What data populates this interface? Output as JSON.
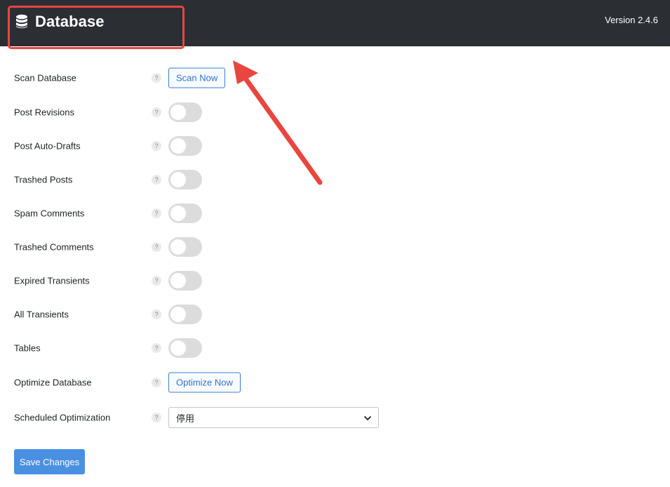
{
  "header": {
    "title": "Database",
    "version": "Version 2.4.6",
    "icon": "database-icon"
  },
  "settings": [
    {
      "label": "Scan Database",
      "help": "?",
      "control": "button",
      "button_label": "Scan Now"
    },
    {
      "label": "Post Revisions",
      "help": "?",
      "control": "toggle",
      "enabled": false
    },
    {
      "label": "Post Auto-Drafts",
      "help": "?",
      "control": "toggle",
      "enabled": false
    },
    {
      "label": "Trashed Posts",
      "help": "?",
      "control": "toggle",
      "enabled": false
    },
    {
      "label": "Spam Comments",
      "help": "?",
      "control": "toggle",
      "enabled": false
    },
    {
      "label": "Trashed Comments",
      "help": "?",
      "control": "toggle",
      "enabled": false
    },
    {
      "label": "Expired Transients",
      "help": "?",
      "control": "toggle",
      "enabled": false
    },
    {
      "label": "All Transients",
      "help": "?",
      "control": "toggle",
      "enabled": false
    },
    {
      "label": "Tables",
      "help": "?",
      "control": "toggle",
      "enabled": false
    },
    {
      "label": "Optimize Database",
      "help": "?",
      "control": "button",
      "button_label": "Optimize Now"
    },
    {
      "label": "Scheduled Optimization",
      "help": "?",
      "control": "select",
      "selected": "停用"
    }
  ],
  "save_label": "Save Changes",
  "colors": {
    "header_bg": "#2b2e33",
    "accent": "#4a90e2",
    "annotation": "#e8463f",
    "toggle_off": "#dcdcdc"
  }
}
